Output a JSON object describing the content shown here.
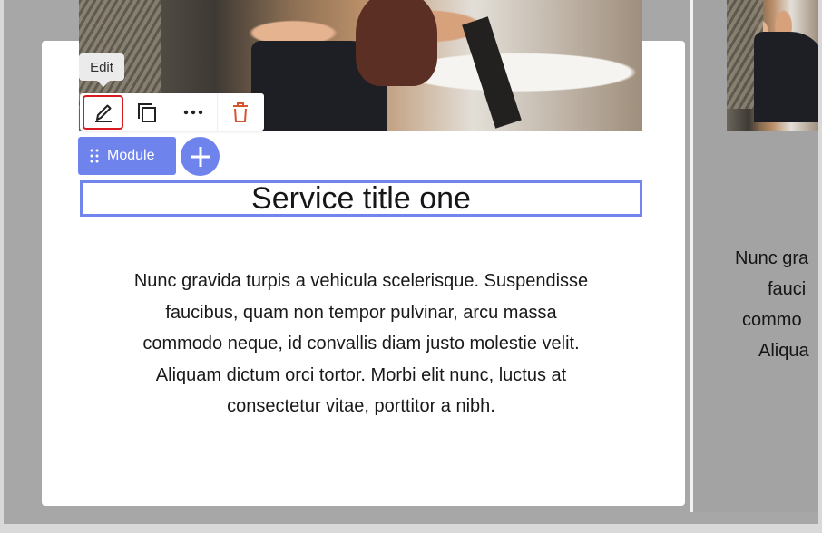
{
  "tooltip": {
    "text": "Edit"
  },
  "toolbar": {
    "buttons": [
      {
        "name": "edit",
        "icon": "pencil-icon",
        "active": true,
        "color": "#222222"
      },
      {
        "name": "duplicate",
        "icon": "copy-icon",
        "color": "#222222"
      },
      {
        "name": "more",
        "icon": "more-dots-icon",
        "color": "#222222"
      },
      {
        "name": "delete",
        "icon": "trash-icon",
        "color": "#d9532c"
      }
    ],
    "active_outline_color": "#d71920"
  },
  "module": {
    "label": "Module",
    "accent_color": "#6f83ed"
  },
  "add_button": {
    "icon": "plus-icon"
  },
  "service": {
    "title": "Service title one",
    "body_lines": [
      "Nunc gravida turpis a vehicula scelerisque. Suspendisse",
      "faucibus, quam non tempor pulvinar, arcu massa",
      "commodo neque, id convallis diam justo molestie velit.",
      "Aliquam dictum orci tortor. Morbi elit nunc, luctus at",
      "consectetur vitae, porttitor a nibh."
    ]
  },
  "adjacent_service": {
    "body_lines": [
      "Nunc gra",
      "fauci",
      "commo",
      "Aliqua"
    ]
  }
}
